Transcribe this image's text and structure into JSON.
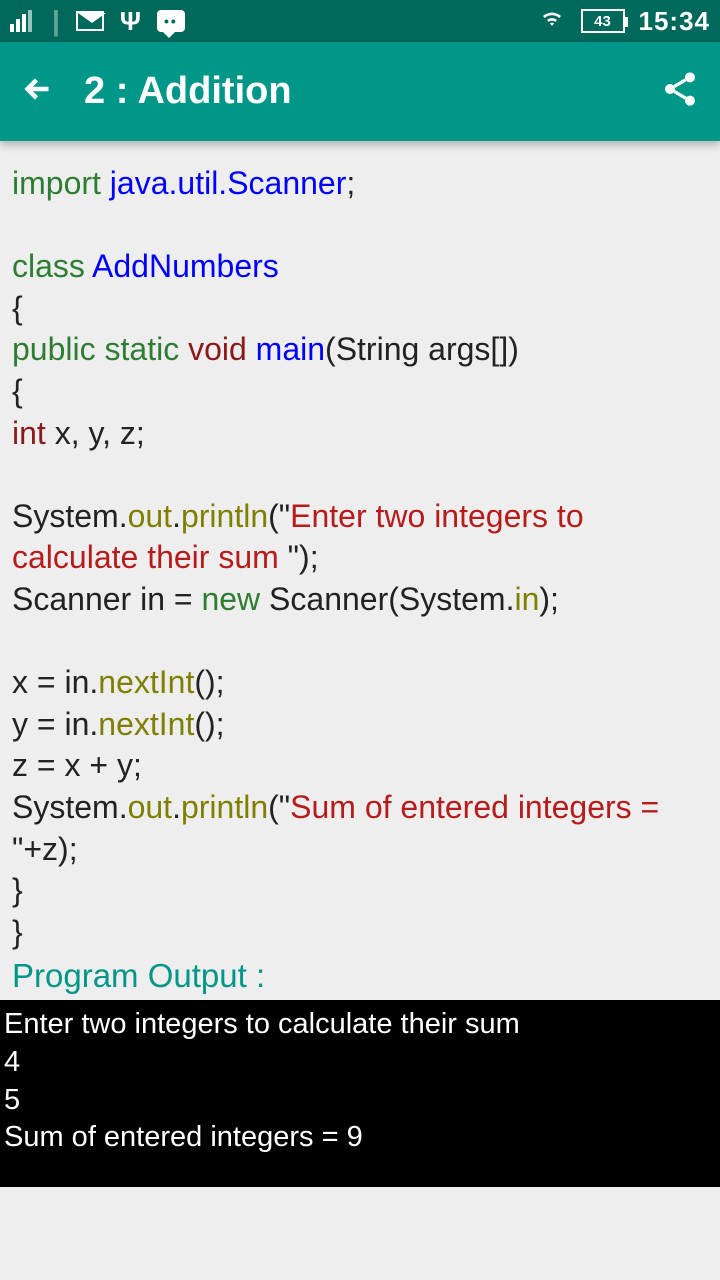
{
  "status": {
    "battery": "43",
    "time": "15:34"
  },
  "header": {
    "title": "2 : Addition"
  },
  "code": {
    "import_kw": "import",
    "import_pkg": "java.util.Scanner",
    "semi": ";",
    "class_kw": "class",
    "class_name": "AddNumbers",
    "lbrace": "{",
    "rbrace": "}",
    "public_kw": "public",
    "static_kw": "static",
    "void_kw": "void",
    "main_kw": "main",
    "main_args": "(String args[])",
    "int_kw": "int",
    "vars_decl": " x, y, z;",
    "sys": "System.",
    "out": "out",
    "dot": ".",
    "println": "println",
    "lparen_q": "(\"",
    "str1": "Enter two integers to calculate their sum ",
    "rparen_q": "\");",
    "scanner_decl": "Scanner in = ",
    "new_kw": "new",
    "scanner_ctor": " Scanner(System.",
    "in_kw": "in",
    "rparen_semi": ");",
    "x_assign": "x = in.",
    "y_assign": "y = in.",
    "nextInt": "nextInt",
    "paren_semi": "();",
    "z_line": "z = x + y;",
    "str2": "Sum of entered integers = ",
    "plus_z": "\"+z);"
  },
  "output": {
    "title": "Program Output :",
    "lines": [
      "Enter two integers to calculate their sum",
      "4",
      "5",
      "Sum of entered integers = 9"
    ]
  }
}
